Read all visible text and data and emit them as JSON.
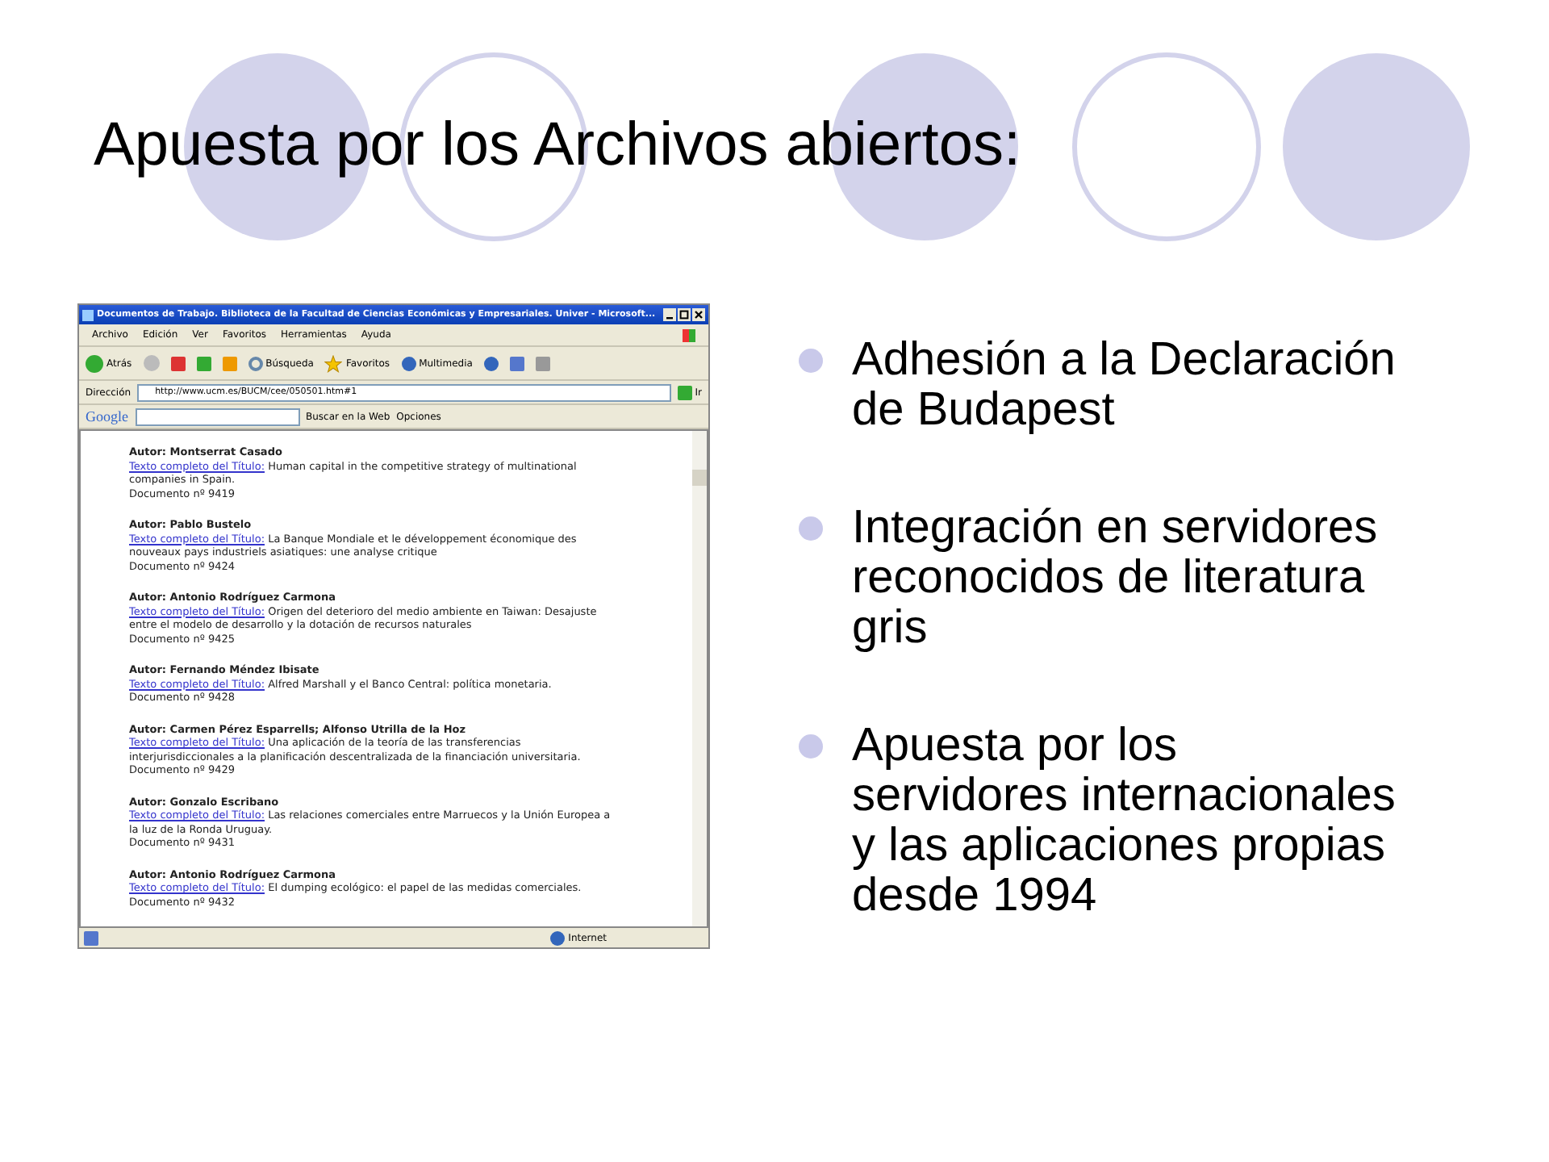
{
  "title": "Apuesta por los Archivos abiertos:",
  "browser": {
    "window_title": "Documentos de Trabajo. Biblioteca de la Facultad de Ciencias Económicas y Empresariales. Univer - Microsoft...",
    "menu": [
      "Archivo",
      "Edición",
      "Ver",
      "Favoritos",
      "Herramientas",
      "Ayuda"
    ],
    "toolbar": [
      "Atrás",
      "Búsqueda",
      "Favoritos",
      "Multimedia"
    ],
    "address": {
      "label": "Dirección",
      "value": "http://www.ucm.es/BUCM/cee/050501.htm#1",
      "go": "Ir"
    },
    "google": {
      "logo": "Google",
      "search_button": "Buscar en la Web",
      "options": "Opciones"
    },
    "entries": [
      {
        "author": "Autor: Montserrat Casado",
        "link": "Texto completo del Título:",
        "text": "Human capital in the competitive strategy of multinational companies in Spain.",
        "document": "Documento nº 9419"
      },
      {
        "author": "Autor: Pablo Bustelo",
        "link": "Texto completo del Título:",
        "text": "La Banque Mondiale et le développement économique des nouveaux pays industriels asiatiques: une analyse critique",
        "document": "Documento nº 9424"
      },
      {
        "author": "Autor: Antonio Rodríguez Carmona",
        "link": "Texto completo del Título:",
        "text": "Origen del deterioro del medio ambiente en Taiwan: Desajuste entre el modelo de desarrollo y la dotación de recursos naturales",
        "document": "Documento nº 9425"
      },
      {
        "author": "Autor: Fernando Méndez Ibisate",
        "link": "Texto completo del Título:",
        "text": "Alfred Marshall y el Banco Central: política monetaria.",
        "document": "Documento nº 9428"
      },
      {
        "author": "Autor: Carmen Pérez Esparrells; Alfonso Utrilla de la Hoz",
        "link": "Texto completo del Título:",
        "text": "Una aplicación de la teoría de las transferencias interjurisdiccionales a la planificación descentralizada de la financiación universitaria.",
        "document": "Documento nº 9429"
      },
      {
        "author": "Autor: Gonzalo Escribano",
        "link": "Texto completo del Título:",
        "text": "Las relaciones comerciales entre Marruecos y la Unión Europea a la luz de la Ronda Uruguay.",
        "document": "Documento nº 9431"
      },
      {
        "author": "Autor: Antonio Rodríguez Carmona",
        "link": "Texto completo del Título:",
        "text": "El dumping ecológico: el papel de las medidas comerciales.",
        "document": "Documento nº 9432"
      }
    ],
    "status": {
      "zone": "Internet"
    }
  },
  "bullets": [
    "Adhesión a la Declaración de Budapest",
    "Integración en servidores reconocidos de literatura gris",
    "Apuesta por los servidores internacionales y las aplicaciones propias desde 1994"
  ]
}
